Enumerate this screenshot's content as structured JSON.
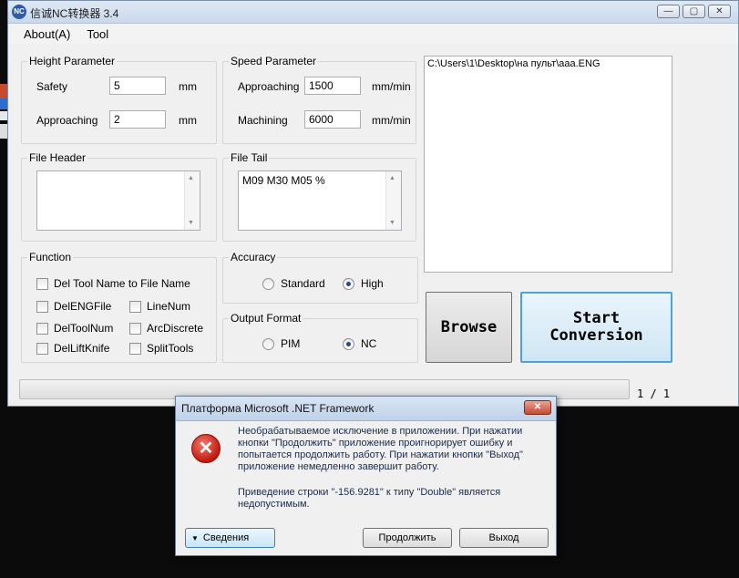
{
  "window": {
    "title": "信诚NC转换器 3.4",
    "icon_text": "NC",
    "minimize": "—",
    "maximize": "▢",
    "close": "✕"
  },
  "menu": {
    "about": "About(A)",
    "tool": "Tool"
  },
  "height_param": {
    "title": "Height Parameter",
    "safety_label": "Safety",
    "safety_value": "5",
    "safety_unit": "mm",
    "approaching_label": "Approaching",
    "approaching_value": "2",
    "approaching_unit": "mm"
  },
  "speed_param": {
    "title": "Speed Parameter",
    "approaching_label": "Approaching",
    "approaching_value": "1500",
    "approaching_unit": "mm/min",
    "machining_label": "Machining",
    "machining_value": "6000",
    "machining_unit": "mm/min"
  },
  "file_header": {
    "title": "File Header",
    "value": ""
  },
  "file_tail": {
    "title": "File Tail",
    "value": "M09 M30 M05 %"
  },
  "function": {
    "title": "Function",
    "del_tool_name": "Del Tool Name to File Name",
    "del_eng_file": "DelENGFile",
    "line_num": "LineNum",
    "del_tool_num": "DelToolNum",
    "arc_discrete": "ArcDiscrete",
    "del_lift_knife": "DelLiftKnife",
    "split_tools": "SplitTools"
  },
  "accuracy": {
    "title": "Accuracy",
    "standard": "Standard",
    "high": "High",
    "selected": "High"
  },
  "output_format": {
    "title": "Output Format",
    "pim": "PIM",
    "nc": "NC",
    "selected": "NC"
  },
  "file_path": "C:\\Users\\1\\Desktop\\на пульт\\aaa.ENG",
  "buttons": {
    "browse": "Browse",
    "start_line1": "Start",
    "start_line2": "Conversion"
  },
  "progress": {
    "fraction": 0.0,
    "counter": "1 / 1"
  },
  "dialog": {
    "title": "Платформа Microsoft .NET Framework",
    "close": "✕",
    "message": "Необрабатываемое исключение в приложении. При нажатии кнопки \"Продолжить\" приложение проигнорирует ошибку и попытается продолжить работу. При нажатии кнопки \"Выход\" приложение немедленно завершит работу.",
    "detail": "Приведение строки \"-156.9281\" к типу \"Double\" является недопустимым.",
    "details_button": "Сведения",
    "continue_button": "Продолжить",
    "exit_button": "Выход",
    "icon_glyph": "✕"
  },
  "colors": {
    "accent": "#4aa3d8",
    "error": "#c2190f",
    "title_bar": "#c9d8eb"
  }
}
